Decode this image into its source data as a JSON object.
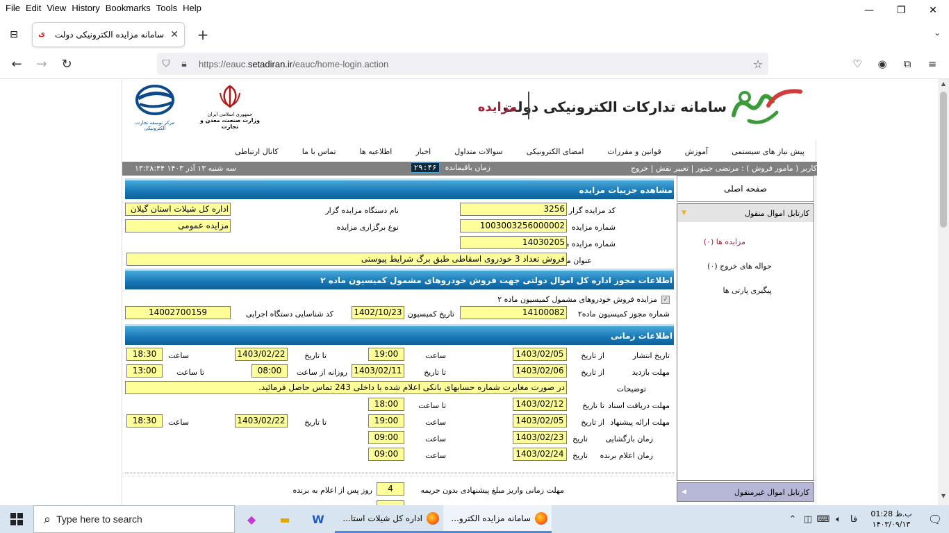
{
  "browser": {
    "menu": [
      "File",
      "Edit",
      "View",
      "History",
      "Bookmarks",
      "Tools",
      "Help"
    ],
    "tab_title": "سامانه مزایده الکترونیکی دولت",
    "url_prefix": "https://eauc.",
    "url_domain": "setadiran.ir",
    "url_path": "/eauc/home-login.action"
  },
  "header": {
    "system_title": "سامانه تدارکات الکترونیکی دولت",
    "subsystem": "مزایده",
    "emblem_line1": "جمهوری اسلامی ایران",
    "emblem_line2": "وزارت صنعت، معدن و تجارت",
    "etc_caption": "مرکز توسعه تجارت الکترونیکی"
  },
  "topnav": [
    "پیش نیاز های سیستمی",
    "آموزش",
    "قوانین و مقررات",
    "امضای الکترونیکی",
    "سوالات متداول",
    "اخبار",
    "اطلاعیه ها",
    "تماس با ما",
    "کانال ارتباطی"
  ],
  "infobar": {
    "user": "کاربر ( مامور فروش ) : مرتضی جینور | تغییر نقش | خروج",
    "timer_label": "زمان باقیمانده",
    "timer_value": "۲۹:۴۶",
    "clock": "سه شنبه ۱۳ آذر ۱۴۰۳    ۱۳:۲۸:۴۴"
  },
  "sidebar": {
    "home": "صفحه اصلی",
    "movable_title": "کارتابل اموال منقول",
    "items": [
      "مزایده ها (۰)",
      "حواله های خروج (۰)",
      "پیگیری پارتی ها"
    ],
    "immovable_title": "کارتابل اموال غیرمنقول"
  },
  "auction": {
    "section_title": "مشاهده جزییات مزایده",
    "code_label": "کد مزایده گزار",
    "code": "3256",
    "org_label": "نام دستگاه مزایده گزار",
    "org": "اداره کل شیلات استان گیلان",
    "number_label": "شماره مزایده",
    "number": "1003003256000002",
    "type_label": "نوع برگزاری مزایده",
    "type": "مزایده عمومی",
    "ref_label": "شماره مزایده مرجع",
    "ref": "14030205",
    "title_label": "عنوان مزایده",
    "title": "فروش تعداد 3 خودروی اسقاطی طبق برگ شرایط پیوستی"
  },
  "permit": {
    "section_title": "اطلاعات مجوز اداره کل اموال دولتی جهت فروش خودروهای مشمول کمیسیون ماده ۲",
    "checkbox_label": "مزایده فروش خودروهای مشمول کمیسیون ماده ۲",
    "permit_label": "شماره مجوز کمیسیون ماده۲",
    "permit": "14100082",
    "date_label": "تاریخ کمیسیون",
    "date": "1402/10/23",
    "exec_label": "کد شناسایی دستگاه اجرایی",
    "exec": "14002700159"
  },
  "timing": {
    "section_title": "اطلاعات زمانی",
    "publish_label": "تاریخ انتشار",
    "from_date": "از تاریخ",
    "to_date": "تا تاریخ",
    "time_label": "ساعت",
    "to_time": "تا ساعت",
    "daily_from": "روزانه از ساعت",
    "visit_label": "مهلت بازدید",
    "desc_label": "توضیحات",
    "docs_label": "مهلت دریافت اسناد",
    "offer_label": "مهلت ارائه پیشنهاد",
    "open_label": "زمان بازگشایی",
    "winner_label": "زمان اعلام برنده",
    "date_word": "تاریخ",
    "publish_from": "1403/02/05",
    "publish_from_time": "19:00",
    "publish_to": "1403/02/22",
    "publish_to_time": "18:30",
    "visit_from": "1403/02/06",
    "visit_to": "1403/02/11",
    "visit_daily_from": "08:00",
    "visit_daily_to": "13:00",
    "desc": "در صورت مغایرت شماره حسابهای بانکی اعلام شده با داخلی 243 تماس حاصل فرمائید.",
    "docs_to": "1403/02/12",
    "docs_to_time": "18:00",
    "offer_from": "1403/02/05",
    "offer_from_time": "19:00",
    "offer_to": "1403/02/22",
    "offer_to_time": "18:30",
    "open_date": "1403/02/23",
    "open_time": "09:00",
    "winner_date": "1403/02/24",
    "winner_time": "09:00"
  },
  "payment": {
    "deadline_label": "مهلت زمانی واریز مبلغ پیشنهادی بدون جریمه",
    "deadline": "4",
    "deadline_suffix": "روز پس از اعلام به برنده"
  },
  "taskbar": {
    "search_placeholder": "Type here to search",
    "win1": "اداره کل شیلات استا...",
    "win2": "سامانه مزایده الکترو...",
    "lang": "فا",
    "clock_time": "ب.ظ 01:28",
    "clock_date": "۱۴۰۳/۰۹/۱۳"
  },
  "colors": {
    "accent": "#1677b6",
    "field": "#ffff99",
    "brand_red": "#a4203a"
  }
}
